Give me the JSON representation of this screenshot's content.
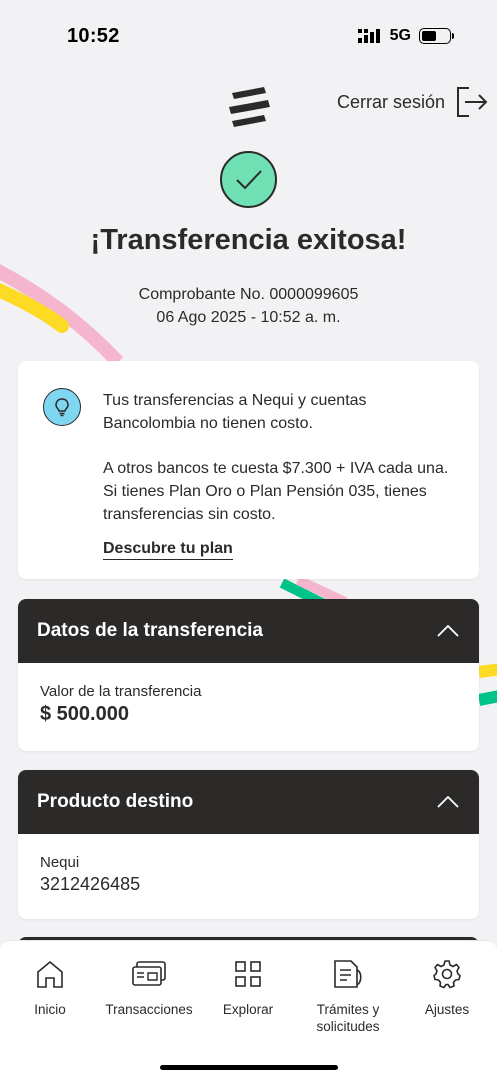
{
  "status": {
    "time": "10:52",
    "network": "5G",
    "battery_level": 0.55
  },
  "header": {
    "logout_label": "Cerrar sesión"
  },
  "result": {
    "title": "¡Transferencia exitosa!",
    "voucher": "Comprobante No. 0000099605",
    "datetime": "06 Ago 2025 - 10:52 a. m."
  },
  "tip": {
    "line1": "Tus transferencias a Nequi y cuentas Bancolombia no tienen costo.",
    "line2": "A otros bancos te cuesta $7.300 + IVA cada una. Si tienes Plan Oro o Plan Pensión 035, tienes transferencias sin costo.",
    "link": "Descubre tu plan"
  },
  "transfer_data": {
    "title": "Datos de la transferencia",
    "amount_label": "Valor de la transferencia",
    "amount": "$ 500.000"
  },
  "destination": {
    "title": "Producto destino",
    "product": "Nequi",
    "number": "3212426485"
  },
  "nav": {
    "items": [
      {
        "label": "Inicio",
        "icon": "home-icon"
      },
      {
        "label": "Transacciones",
        "icon": "cards-icon"
      },
      {
        "label": "Explorar",
        "icon": "grid-icon"
      },
      {
        "label": "Trámites y solicitudes",
        "icon": "documents-icon"
      },
      {
        "label": "Ajustes",
        "icon": "gear-icon"
      }
    ]
  },
  "colors": {
    "dark": "#2c2a29",
    "success": "#6ee0b4",
    "info": "#7fd6f0",
    "yellow": "#fdda24",
    "pink": "#f5b6cd",
    "green": "#00c389"
  }
}
